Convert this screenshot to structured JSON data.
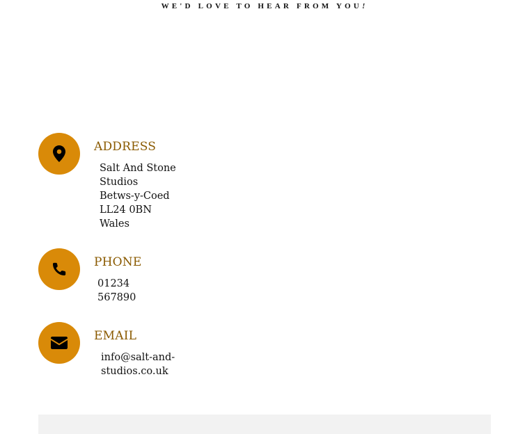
{
  "header": {
    "tagline_main": "WE'D LOVE TO HEAR FROM YOU",
    "tagline_end": "!"
  },
  "contact": {
    "address": {
      "icon": "map-pin-icon",
      "title": "ADDRESS",
      "lines": [
        "Salt And Stone",
        "Studios",
        "Betws-y-Coed",
        "LL24 0BN",
        "Wales"
      ]
    },
    "phone": {
      "icon": "phone-icon",
      "title": "PHONE",
      "lines": [
        "01234",
        "567890"
      ]
    },
    "email": {
      "icon": "envelope-icon",
      "title": "EMAIL",
      "lines": [
        "info@salt-and-",
        "studios.co.uk"
      ]
    }
  },
  "colors": {
    "accent": "#d98a08",
    "title": "#8a5a00",
    "text": "#111111",
    "footer_band": "#f2f2f2"
  }
}
